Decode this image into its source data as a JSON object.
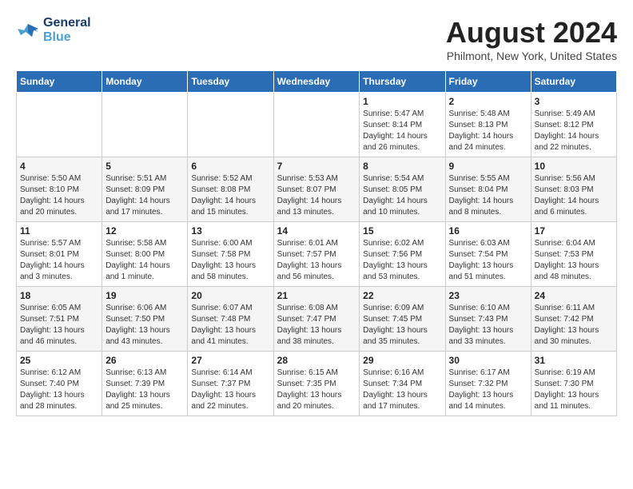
{
  "logo": {
    "line1": "General",
    "line2": "Blue"
  },
  "title": "August 2024",
  "subtitle": "Philmont, New York, United States",
  "days_of_week": [
    "Sunday",
    "Monday",
    "Tuesday",
    "Wednesday",
    "Thursday",
    "Friday",
    "Saturday"
  ],
  "weeks": [
    [
      {
        "day": "",
        "info": ""
      },
      {
        "day": "",
        "info": ""
      },
      {
        "day": "",
        "info": ""
      },
      {
        "day": "",
        "info": ""
      },
      {
        "day": "1",
        "info": "Sunrise: 5:47 AM\nSunset: 8:14 PM\nDaylight: 14 hours\nand 26 minutes."
      },
      {
        "day": "2",
        "info": "Sunrise: 5:48 AM\nSunset: 8:13 PM\nDaylight: 14 hours\nand 24 minutes."
      },
      {
        "day": "3",
        "info": "Sunrise: 5:49 AM\nSunset: 8:12 PM\nDaylight: 14 hours\nand 22 minutes."
      }
    ],
    [
      {
        "day": "4",
        "info": "Sunrise: 5:50 AM\nSunset: 8:10 PM\nDaylight: 14 hours\nand 20 minutes."
      },
      {
        "day": "5",
        "info": "Sunrise: 5:51 AM\nSunset: 8:09 PM\nDaylight: 14 hours\nand 17 minutes."
      },
      {
        "day": "6",
        "info": "Sunrise: 5:52 AM\nSunset: 8:08 PM\nDaylight: 14 hours\nand 15 minutes."
      },
      {
        "day": "7",
        "info": "Sunrise: 5:53 AM\nSunset: 8:07 PM\nDaylight: 14 hours\nand 13 minutes."
      },
      {
        "day": "8",
        "info": "Sunrise: 5:54 AM\nSunset: 8:05 PM\nDaylight: 14 hours\nand 10 minutes."
      },
      {
        "day": "9",
        "info": "Sunrise: 5:55 AM\nSunset: 8:04 PM\nDaylight: 14 hours\nand 8 minutes."
      },
      {
        "day": "10",
        "info": "Sunrise: 5:56 AM\nSunset: 8:03 PM\nDaylight: 14 hours\nand 6 minutes."
      }
    ],
    [
      {
        "day": "11",
        "info": "Sunrise: 5:57 AM\nSunset: 8:01 PM\nDaylight: 14 hours\nand 3 minutes."
      },
      {
        "day": "12",
        "info": "Sunrise: 5:58 AM\nSunset: 8:00 PM\nDaylight: 14 hours\nand 1 minute."
      },
      {
        "day": "13",
        "info": "Sunrise: 6:00 AM\nSunset: 7:58 PM\nDaylight: 13 hours\nand 58 minutes."
      },
      {
        "day": "14",
        "info": "Sunrise: 6:01 AM\nSunset: 7:57 PM\nDaylight: 13 hours\nand 56 minutes."
      },
      {
        "day": "15",
        "info": "Sunrise: 6:02 AM\nSunset: 7:56 PM\nDaylight: 13 hours\nand 53 minutes."
      },
      {
        "day": "16",
        "info": "Sunrise: 6:03 AM\nSunset: 7:54 PM\nDaylight: 13 hours\nand 51 minutes."
      },
      {
        "day": "17",
        "info": "Sunrise: 6:04 AM\nSunset: 7:53 PM\nDaylight: 13 hours\nand 48 minutes."
      }
    ],
    [
      {
        "day": "18",
        "info": "Sunrise: 6:05 AM\nSunset: 7:51 PM\nDaylight: 13 hours\nand 46 minutes."
      },
      {
        "day": "19",
        "info": "Sunrise: 6:06 AM\nSunset: 7:50 PM\nDaylight: 13 hours\nand 43 minutes."
      },
      {
        "day": "20",
        "info": "Sunrise: 6:07 AM\nSunset: 7:48 PM\nDaylight: 13 hours\nand 41 minutes."
      },
      {
        "day": "21",
        "info": "Sunrise: 6:08 AM\nSunset: 7:47 PM\nDaylight: 13 hours\nand 38 minutes."
      },
      {
        "day": "22",
        "info": "Sunrise: 6:09 AM\nSunset: 7:45 PM\nDaylight: 13 hours\nand 35 minutes."
      },
      {
        "day": "23",
        "info": "Sunrise: 6:10 AM\nSunset: 7:43 PM\nDaylight: 13 hours\nand 33 minutes."
      },
      {
        "day": "24",
        "info": "Sunrise: 6:11 AM\nSunset: 7:42 PM\nDaylight: 13 hours\nand 30 minutes."
      }
    ],
    [
      {
        "day": "25",
        "info": "Sunrise: 6:12 AM\nSunset: 7:40 PM\nDaylight: 13 hours\nand 28 minutes."
      },
      {
        "day": "26",
        "info": "Sunrise: 6:13 AM\nSunset: 7:39 PM\nDaylight: 13 hours\nand 25 minutes."
      },
      {
        "day": "27",
        "info": "Sunrise: 6:14 AM\nSunset: 7:37 PM\nDaylight: 13 hours\nand 22 minutes."
      },
      {
        "day": "28",
        "info": "Sunrise: 6:15 AM\nSunset: 7:35 PM\nDaylight: 13 hours\nand 20 minutes."
      },
      {
        "day": "29",
        "info": "Sunrise: 6:16 AM\nSunset: 7:34 PM\nDaylight: 13 hours\nand 17 minutes."
      },
      {
        "day": "30",
        "info": "Sunrise: 6:17 AM\nSunset: 7:32 PM\nDaylight: 13 hours\nand 14 minutes."
      },
      {
        "day": "31",
        "info": "Sunrise: 6:19 AM\nSunset: 7:30 PM\nDaylight: 13 hours\nand 11 minutes."
      }
    ]
  ]
}
